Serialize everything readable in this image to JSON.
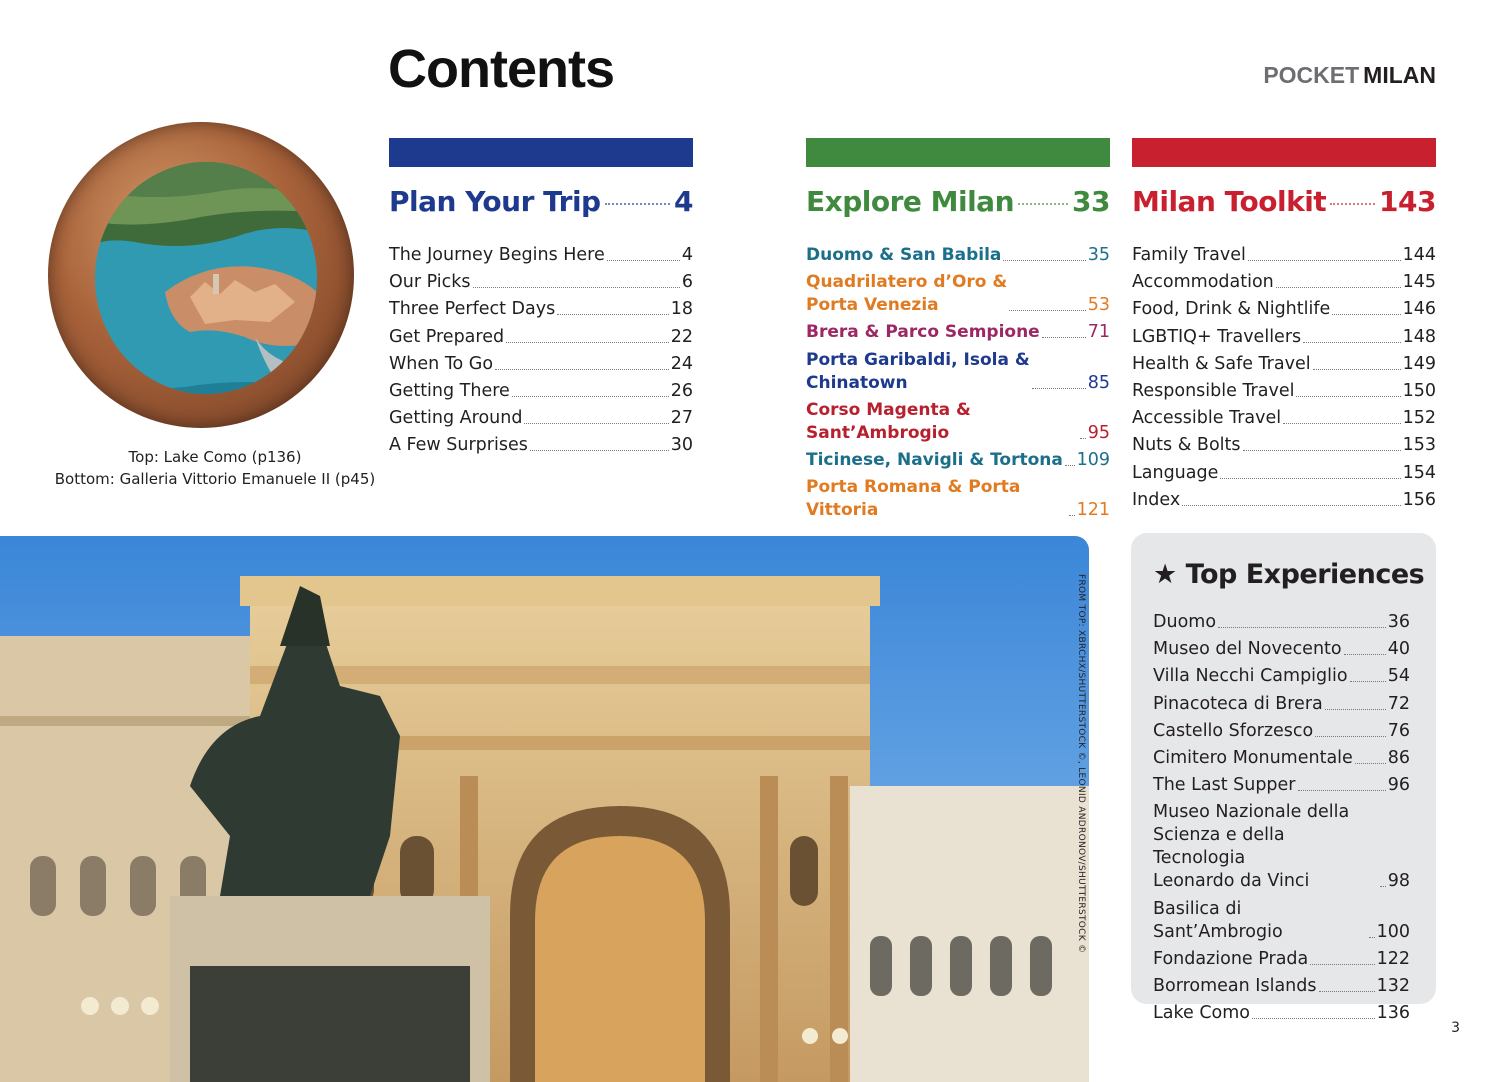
{
  "header": {
    "title": "Contents",
    "brand_pocket": "POCKET",
    "brand_city": "MILAN"
  },
  "caption": {
    "line1": "Top: Lake Como (p136)",
    "line2": "Bottom: Galleria Vittorio Emanuele II (p45)"
  },
  "colors": {
    "plan": "#1e3a8e",
    "explore": "#3f8a3f",
    "toolkit": "#c8202f"
  },
  "plan": {
    "title": "Plan Your Trip",
    "page": "4",
    "items": [
      {
        "label": "The Journey Begins Here",
        "page": "4"
      },
      {
        "label": "Our Picks",
        "page": "6"
      },
      {
        "label": "Three Perfect Days",
        "page": "18"
      },
      {
        "label": "Get Prepared",
        "page": "22"
      },
      {
        "label": "When To Go",
        "page": "24"
      },
      {
        "label": "Getting There",
        "page": "26"
      },
      {
        "label": "Getting Around",
        "page": "27"
      },
      {
        "label": "A Few Surprises",
        "page": "30"
      }
    ]
  },
  "explore": {
    "title": "Explore Milan",
    "page": "33",
    "items": [
      {
        "label": "Duomo & San Babila",
        "page": "35",
        "color": "#1c6f8a"
      },
      {
        "label": "Quadrilatero d’Oro &\nPorta Venezia",
        "page": "53",
        "color": "#e07b22"
      },
      {
        "label": "Brera & Parco Sempione",
        "page": "71",
        "color": "#9c2765"
      },
      {
        "label": "Porta Garibaldi, Isola &\nChinatown",
        "page": "85",
        "color": "#1e3a8e"
      },
      {
        "label": "Corso Magenta & Sant’Ambrogio",
        "page": "95",
        "color": "#b8202d"
      },
      {
        "label": "Ticinese, Navigli & Tortona",
        "page": "109",
        "color": "#1c6f8a"
      },
      {
        "label": "Porta Romana & Porta Vittoria",
        "page": "121",
        "color": "#e07b22"
      }
    ]
  },
  "toolkit": {
    "title": "Milan Toolkit",
    "page": "143",
    "items": [
      {
        "label": "Family Travel",
        "page": "144"
      },
      {
        "label": "Accommodation",
        "page": "145"
      },
      {
        "label": "Food, Drink & Nightlife",
        "page": "146"
      },
      {
        "label": "LGBTIQ+ Travellers",
        "page": "148"
      },
      {
        "label": "Health & Safe Travel",
        "page": "149"
      },
      {
        "label": "Responsible Travel",
        "page": "150"
      },
      {
        "label": "Accessible Travel",
        "page": "152"
      },
      {
        "label": "Nuts & Bolts",
        "page": "153"
      },
      {
        "label": "Language",
        "page": "154"
      },
      {
        "label": "Index",
        "page": "156"
      }
    ]
  },
  "top_experiences": {
    "title": "Top Experiences",
    "star": "★",
    "items": [
      {
        "label": "Duomo",
        "page": "36"
      },
      {
        "label": "Museo del Novecento",
        "page": "40"
      },
      {
        "label": "Villa Necchi Campiglio",
        "page": "54"
      },
      {
        "label": "Pinacoteca di Brera",
        "page": "72"
      },
      {
        "label": "Castello Sforzesco",
        "page": "76"
      },
      {
        "label": "Cimitero Monumentale",
        "page": "86"
      },
      {
        "label": "The Last Supper",
        "page": "96"
      },
      {
        "label": "Museo Nazionale della\nScienza e della Tecnologia\nLeonardo da Vinci",
        "page": "98"
      },
      {
        "label": "Basilica di Sant’Ambrogio",
        "page": "100"
      },
      {
        "label": "Fondazione Prada",
        "page": "122"
      },
      {
        "label": "Borromean Islands",
        "page": "132"
      },
      {
        "label": "Lake Como",
        "page": "136"
      }
    ]
  },
  "photo_credit": "FROM TOP: XBRCHX/SHUTTERSTOCK ©, LEONID ANDRONOV/SHUTTERSTOCK ©",
  "page_number": "3"
}
